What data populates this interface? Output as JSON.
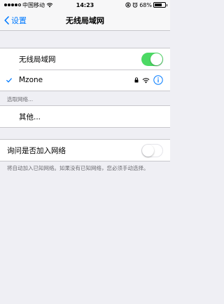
{
  "status_bar": {
    "carrier": "中国移动",
    "time": "14:23",
    "battery": "68%",
    "battery_level": 0.68,
    "signal_bars_filled": 4,
    "signal_bars_total": 5
  },
  "nav": {
    "back_label": "设置",
    "title": "无线局域网"
  },
  "wifi_toggle": {
    "label": "无线局域网",
    "on": true
  },
  "connected_network": {
    "name": "Mzone",
    "icons": [
      "checkmark-icon",
      "lock-icon",
      "wifi-icon",
      "info-icon"
    ]
  },
  "choose_network": {
    "header": "选取网络...",
    "other_label": "其他..."
  },
  "ask_to_join": {
    "label": "询问是否加入网络",
    "on": false,
    "note": "将自动加入已知网络。如果没有已知网络，您必须手动选择。"
  },
  "colors": {
    "accent": "#007aff",
    "toggle_on": "#4cd964",
    "background": "#efeff4"
  }
}
